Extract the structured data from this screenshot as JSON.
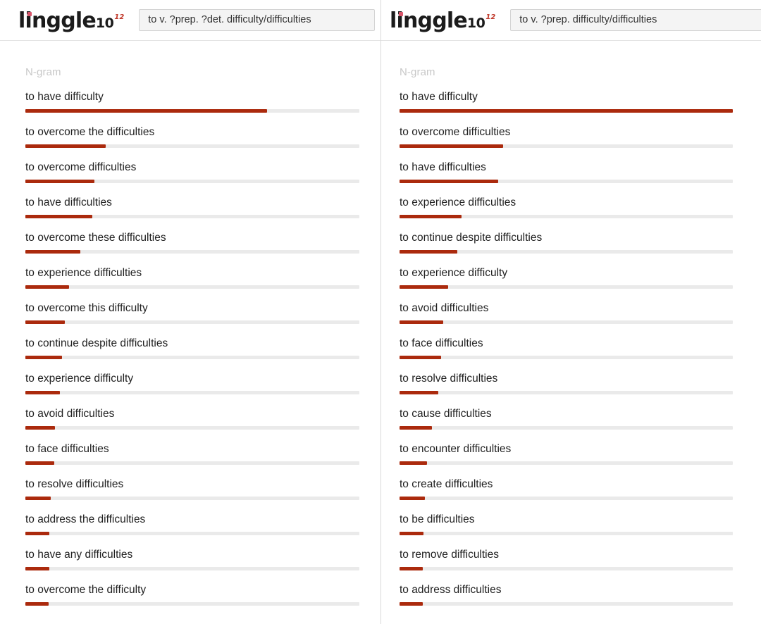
{
  "brand": {
    "word": "linggle",
    "base": "10",
    "exponent": "12",
    "dot_color": "#d8556b",
    "exponent_color": "#c0392b"
  },
  "theme": {
    "bar_color": "#ab2a0d",
    "track_color": "#eaeaea",
    "text_color": "#212121",
    "muted_color": "#c8c8c8",
    "input_bg": "#f4f4f4",
    "input_border": "#d4d4d4"
  },
  "panels": [
    {
      "id": "left",
      "query": "to v. ?prep. ?det. difficulty/difficulties",
      "query_placeholder": "to v. ?prep. ?det. difficulty/difficulties",
      "column_header": "N-gram",
      "rows": [
        {
          "ngram": "to have difficulty",
          "percent": 21.0
        },
        {
          "ngram": "to overcome the difficulties",
          "percent": 7.0
        },
        {
          "ngram": "to overcome difficulties",
          "percent": 6.0
        },
        {
          "ngram": "to have difficulties",
          "percent": 5.8
        },
        {
          "ngram": "to overcome these difficulties",
          "percent": 4.8
        },
        {
          "ngram": "to experience difficulties",
          "percent": 3.8
        },
        {
          "ngram": "to overcome this difficulty",
          "percent": 3.4
        },
        {
          "ngram": "to continue despite difficulties",
          "percent": 3.2
        },
        {
          "ngram": "to experience difficulty",
          "percent": 3.0
        },
        {
          "ngram": "to avoid difficulties",
          "percent": 2.6
        },
        {
          "ngram": "to face difficulties",
          "percent": 2.5
        },
        {
          "ngram": "to resolve difficulties",
          "percent": 2.2
        },
        {
          "ngram": "to address the difficulties",
          "percent": 2.1
        },
        {
          "ngram": "to have any difficulties",
          "percent": 2.1
        },
        {
          "ngram": "to overcome the difficulty",
          "percent": 2.0
        }
      ]
    },
    {
      "id": "right",
      "query": "to v. ?prep. difficulty/difficulties",
      "query_placeholder": "to v. ?prep. difficulty/difficulties",
      "column_header": "N-gram",
      "rows": [
        {
          "ngram": "to have difficulty",
          "percent": 29.0
        },
        {
          "ngram": "to overcome difficulties",
          "percent": 9.0
        },
        {
          "ngram": "to have difficulties",
          "percent": 8.6
        },
        {
          "ngram": "to experience difficulties",
          "percent": 5.4
        },
        {
          "ngram": "to continue despite difficulties",
          "percent": 5.0
        },
        {
          "ngram": "to experience difficulty",
          "percent": 4.2
        },
        {
          "ngram": "to avoid difficulties",
          "percent": 3.8
        },
        {
          "ngram": "to face difficulties",
          "percent": 3.6
        },
        {
          "ngram": "to resolve difficulties",
          "percent": 3.4
        },
        {
          "ngram": "to cause difficulties",
          "percent": 2.8
        },
        {
          "ngram": "to encounter difficulties",
          "percent": 2.4
        },
        {
          "ngram": "to create difficulties",
          "percent": 2.2
        },
        {
          "ngram": "to be difficulties",
          "percent": 2.1
        },
        {
          "ngram": "to remove difficulties",
          "percent": 2.0
        },
        {
          "ngram": "to address difficulties",
          "percent": 2.0
        }
      ]
    }
  ],
  "chart_data": [
    {
      "type": "bar",
      "title": "N-gram frequency — to v. ?prep. ?det. difficulty/difficulties",
      "xlabel": "",
      "ylabel": "N-gram",
      "orientation": "horizontal",
      "grid": false,
      "legend": "none",
      "xlim": [
        0,
        100
      ],
      "categories": [
        "to have difficulty",
        "to overcome the difficulties",
        "to overcome difficulties",
        "to have difficulties",
        "to overcome these difficulties",
        "to experience difficulties",
        "to overcome this difficulty",
        "to continue despite difficulties",
        "to experience difficulty",
        "to avoid difficulties",
        "to face difficulties",
        "to resolve difficulties",
        "to address the difficulties",
        "to have any difficulties",
        "to overcome the difficulty"
      ],
      "values": [
        21.0,
        7.0,
        6.0,
        5.8,
        4.8,
        3.8,
        3.4,
        3.2,
        3.0,
        2.6,
        2.5,
        2.2,
        2.1,
        2.1,
        2.0
      ]
    },
    {
      "type": "bar",
      "title": "N-gram frequency — to v. ?prep. difficulty/difficulties",
      "xlabel": "",
      "ylabel": "N-gram",
      "orientation": "horizontal",
      "grid": false,
      "legend": "none",
      "xlim": [
        0,
        100
      ],
      "categories": [
        "to have difficulty",
        "to overcome difficulties",
        "to have difficulties",
        "to experience difficulties",
        "to continue despite difficulties",
        "to experience difficulty",
        "to avoid difficulties",
        "to face difficulties",
        "to resolve difficulties",
        "to cause difficulties",
        "to encounter difficulties",
        "to create difficulties",
        "to be difficulties",
        "to remove difficulties",
        "to address difficulties"
      ],
      "values": [
        29.0,
        9.0,
        8.6,
        5.4,
        5.0,
        4.2,
        3.8,
        3.6,
        3.4,
        2.8,
        2.4,
        2.2,
        2.1,
        2.0,
        2.0
      ]
    }
  ]
}
